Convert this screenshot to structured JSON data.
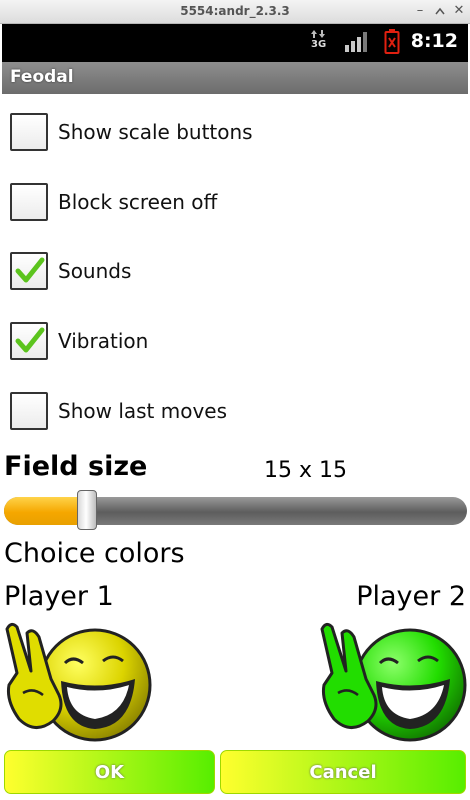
{
  "window": {
    "title": "5554:andr_2.3.3",
    "controls": [
      "minimize-icon",
      "maximize-icon",
      "close-icon"
    ]
  },
  "status_bar": {
    "icons": [
      "data-3g-icon",
      "signal-icon",
      "battery-icon"
    ],
    "network_label": "3G",
    "time": "8:12"
  },
  "app": {
    "title": "Feodal"
  },
  "settings": {
    "checkboxes": [
      {
        "label": "Show scale buttons",
        "checked": false
      },
      {
        "label": "Block screen off",
        "checked": false
      },
      {
        "label": "Sounds",
        "checked": true
      },
      {
        "label": "Vibration",
        "checked": true
      },
      {
        "label": "Show last moves",
        "checked": false
      }
    ]
  },
  "field_size": {
    "title": "Field size",
    "value": "15 x 15",
    "slider_fraction": 0.18
  },
  "colors": {
    "title": "Choice colors",
    "player1": {
      "label": "Player 1",
      "color": "#e0dd00"
    },
    "player2": {
      "label": "Player 2",
      "color": "#22dd00"
    }
  },
  "buttons": {
    "ok": "OK",
    "cancel": "Cancel"
  },
  "theme": {
    "check_green": "#5cc41e",
    "slider_orange": "#f5a700"
  }
}
